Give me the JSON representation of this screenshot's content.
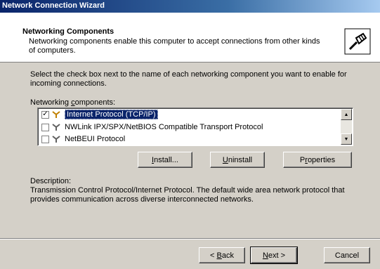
{
  "window": {
    "title": "Network Connection Wizard"
  },
  "header": {
    "title": "Networking Components",
    "subtitle": "Networking components enable this computer to accept connections from other kinds of computers.",
    "icon": "network-cable-icon"
  },
  "instructions": "Select the check box next to the name of each networking component you want to enable for incoming connections.",
  "components_label": "Networking components:",
  "components": [
    {
      "label": "Internet Protocol (TCP/IP)",
      "checked": true,
      "selected": true
    },
    {
      "label": "NWLink IPX/SPX/NetBIOS Compatible Transport Protocol",
      "checked": false,
      "selected": false
    },
    {
      "label": "NetBEUI Protocol",
      "checked": false,
      "selected": false
    }
  ],
  "buttons": {
    "install": "Install...",
    "uninstall": "Uninstall",
    "properties": "Properties",
    "back": "< Back",
    "next": "Next >",
    "cancel": "Cancel"
  },
  "description": {
    "label": "Description:",
    "text": "Transmission Control Protocol/Internet Protocol. The default wide area network protocol that provides communication across diverse interconnected networks."
  }
}
